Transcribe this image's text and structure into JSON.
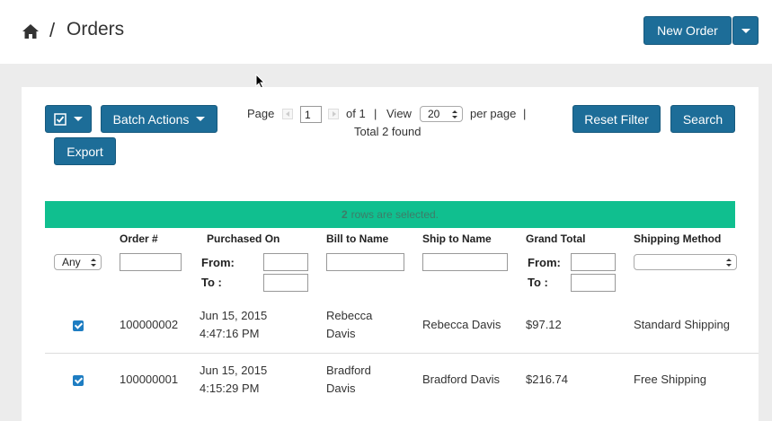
{
  "breadcrumb": {
    "separator": "/",
    "title": "Orders"
  },
  "header": {
    "new_order_label": "New Order"
  },
  "toolbar": {
    "batch_actions_label": "Batch Actions",
    "export_label": "Export",
    "reset_filter_label": "Reset Filter",
    "search_label": "Search"
  },
  "pager": {
    "page_label": "Page",
    "page_value": "1",
    "of_label": "of 1",
    "divider": "|",
    "view_label": "View",
    "per_page_value": "20",
    "per_page_label": "per page",
    "total_label": "Total 2 found"
  },
  "selection": {
    "count": "2",
    "text": "rows are selected."
  },
  "columns": {
    "order_number": "Order #",
    "purchased_on": "Purchased On",
    "bill_to": "Bill to Name",
    "ship_to": "Ship to Name",
    "grand_total": "Grand Total",
    "shipping_method": "Shipping Method"
  },
  "filters": {
    "any_select": "Any",
    "from_label": "From:",
    "to_label": "To :"
  },
  "rows": [
    {
      "selected": true,
      "order_number": "100000002",
      "purchased_date": "Jun 15, 2015",
      "purchased_time": "4:47:16 PM",
      "bill_first": "Rebecca",
      "bill_last": "Davis",
      "ship_to": "Rebecca Davis",
      "grand_total": "$97.12",
      "shipping_method": "Standard Shipping"
    },
    {
      "selected": true,
      "order_number": "100000001",
      "purchased_date": "Jun 15, 2015",
      "purchased_time": "4:15:29 PM",
      "bill_first": "Bradford",
      "bill_last": "Davis",
      "ship_to": "Bradford Davis",
      "grand_total": "$216.74",
      "shipping_method": "Free Shipping"
    }
  ],
  "icons": [
    "home-icon",
    "caret-down-icon",
    "checkbox-icon",
    "mouse-cursor-icon"
  ],
  "colors": {
    "primary_button": "#1d6d98",
    "selection_banner": "#10bf8f",
    "checkbox": "#1e7dc2"
  }
}
